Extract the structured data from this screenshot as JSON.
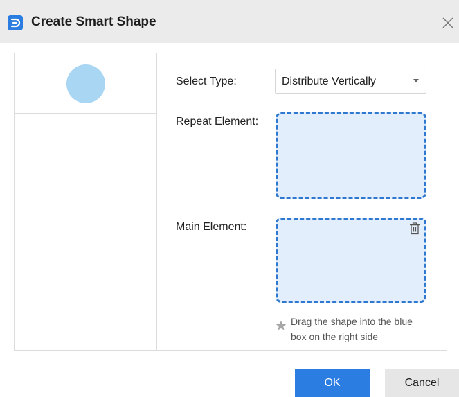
{
  "window": {
    "title": "Create Smart Shape"
  },
  "form": {
    "select_type_label": "Select Type:",
    "select_type_value": "Distribute Vertically",
    "repeat_element_label": "Repeat Element:",
    "main_element_label": "Main Element:"
  },
  "hint": {
    "text": "Drag the shape into the blue box on the right side"
  },
  "buttons": {
    "ok_label": "OK",
    "cancel_label": "Cancel"
  },
  "colors": {
    "accent": "#2b7de1",
    "dropzone_border": "#2f78cf",
    "dropzone_fill": "#e2eefb",
    "thumbnail_shape": "#a8d6f3",
    "titlebar": "#ebebeb"
  },
  "icons": {
    "app": "app-logo-icon",
    "close": "close-icon",
    "delete": "trash-icon",
    "hint": "star-icon",
    "dropdown": "chevron-down-icon"
  }
}
